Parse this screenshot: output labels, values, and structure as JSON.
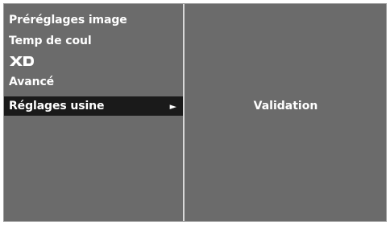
{
  "menu": {
    "items": [
      {
        "label": "Préréglages image"
      },
      {
        "label": "Temp de coul"
      },
      {
        "label": "XD",
        "icon": "xd-logo-icon"
      },
      {
        "label": "Avancé"
      },
      {
        "label": "Réglages usine",
        "selected": true,
        "arrow": "►"
      }
    ]
  },
  "submenu": {
    "option": "Validation"
  },
  "colors": {
    "panel": "#6b6b6b",
    "selected": "#1a1a1a",
    "text": "#ffffff",
    "divider": "#d8d8d8"
  }
}
